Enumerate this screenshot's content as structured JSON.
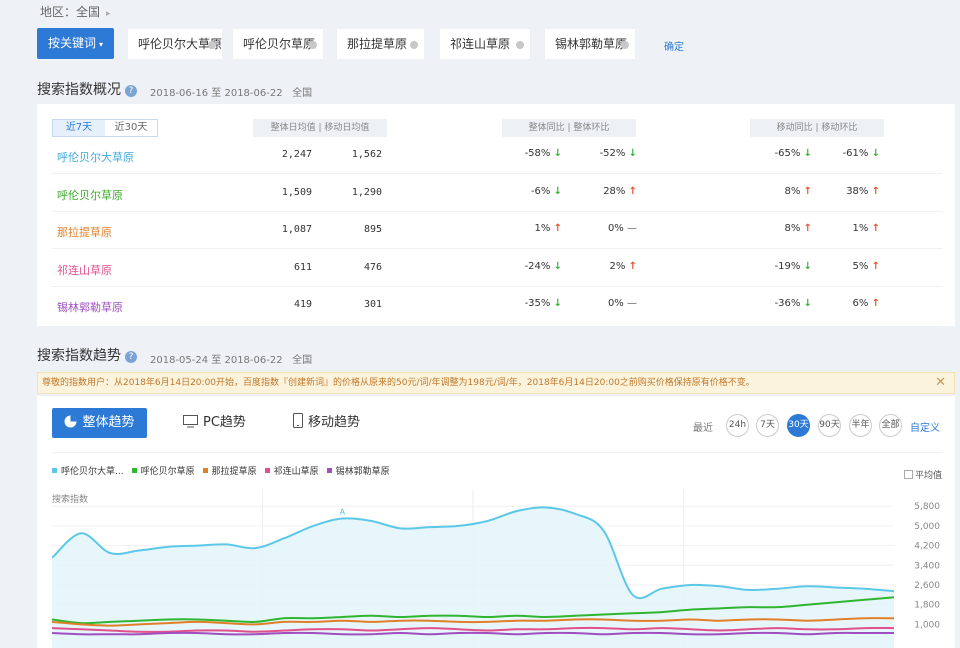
{
  "region": {
    "label": "地区：全国",
    "caret": "▸"
  },
  "keywords": {
    "button_label": "按关键词",
    "items": [
      "呼伦贝尔大草原",
      "呼伦贝尔草原",
      "那拉提草原",
      "祁连山草原",
      "锡林郭勒草原"
    ],
    "confirm": "确定"
  },
  "overview": {
    "title": "搜索指数概况",
    "help_icon": "?",
    "date_range": "2018-06-16 至 2018-06-22",
    "area": "全国",
    "tabs": [
      "近7天",
      "近30天"
    ],
    "headers": {
      "daily": "整体日均值 | 移动日均值",
      "overall": "整体同比 | 整体环比",
      "mobile": "移动同比 | 移动环比"
    },
    "rows": [
      {
        "name": "呼伦贝尔大草原",
        "color": "#3fa9d8",
        "total": "2,247",
        "mobile": "1,562",
        "o_yoy": "-58%",
        "o_yoy_dir": "down",
        "o_mom": "-52%",
        "o_mom_dir": "down",
        "m_yoy": "-65%",
        "m_yoy_dir": "down",
        "m_mom": "-61%",
        "m_mom_dir": "down"
      },
      {
        "name": "呼伦贝尔草原",
        "color": "#3daa2a",
        "total": "1,509",
        "mobile": "1,290",
        "o_yoy": "-6%",
        "o_yoy_dir": "down",
        "o_mom": "28%",
        "o_mom_dir": "up",
        "m_yoy": "8%",
        "m_yoy_dir": "up",
        "m_mom": "38%",
        "m_mom_dir": "up"
      },
      {
        "name": "那拉提草原",
        "color": "#e07f28",
        "total": "1,087",
        "mobile": "895",
        "o_yoy": "1%",
        "o_yoy_dir": "up",
        "o_mom": "0%",
        "o_mom_dir": "flat",
        "m_yoy": "8%",
        "m_yoy_dir": "up",
        "m_mom": "1%",
        "m_mom_dir": "up"
      },
      {
        "name": "祁连山草原",
        "color": "#e0508a",
        "total": "611",
        "mobile": "476",
        "o_yoy": "-24%",
        "o_yoy_dir": "down",
        "o_mom": "2%",
        "o_mom_dir": "up",
        "m_yoy": "-19%",
        "m_yoy_dir": "down",
        "m_mom": "5%",
        "m_mom_dir": "up"
      },
      {
        "name": "锡林郭勒草原",
        "color": "#a04fbf",
        "total": "419",
        "mobile": "301",
        "o_yoy": "-35%",
        "o_yoy_dir": "down",
        "o_mom": "0%",
        "o_mom_dir": "flat",
        "m_yoy": "-36%",
        "m_yoy_dir": "down",
        "m_mom": "6%",
        "m_mom_dir": "up"
      }
    ]
  },
  "trend": {
    "title": "搜索指数趋势",
    "help_icon": "?",
    "date_range": "2018-05-24 至 2018-06-22",
    "area": "全国",
    "notice": "尊敬的指数用户：从2018年6月14日20:00开始，百度指数『创建新词』的价格从原来的50元/词/年调整为198元/词/年，2018年6月14日20:00之前购买价格保持原有价格不变。",
    "notice_close": "✕",
    "modes": [
      "整体趋势",
      "PC趋势",
      "移动趋势"
    ],
    "range_label": "最近",
    "ranges": [
      "24h",
      "7天",
      "30天",
      "90天",
      "半年",
      "全部"
    ],
    "range_selected": "30天",
    "custom": "自定义",
    "legend": [
      "呼伦贝尔大草...",
      "呼伦贝尔草原",
      "那拉提草原",
      "祁连山草原",
      "锡林郭勒草原"
    ],
    "avg_label": "平均值",
    "y_label": "搜索指数",
    "peak_marker": "A"
  },
  "chart_data": {
    "type": "area",
    "ylabel": "搜索指数",
    "ylim": [
      0,
      6500
    ],
    "yticks": [
      "5,800",
      "5,000",
      "4,200",
      "3,400",
      "2,600",
      "1,800",
      "1,000"
    ],
    "grid": true,
    "legend_position": "top-left",
    "series": [
      {
        "name": "呼伦贝尔大草...",
        "color": "#5bc8e8",
        "values": [
          3700,
          4700,
          3900,
          4000,
          4150,
          4200,
          4250,
          4100,
          4500,
          5000,
          5300,
          5200,
          4900,
          4950,
          5000,
          5200,
          5600,
          5750,
          5500,
          4800,
          2200,
          2450,
          2600,
          2550,
          2400,
          2450,
          2550,
          2500,
          2450,
          2350
        ]
      },
      {
        "name": "呼伦贝尔草原",
        "color": "#2fb52f",
        "values": [
          1200,
          1050,
          1100,
          1150,
          1200,
          1200,
          1150,
          1100,
          1250,
          1250,
          1300,
          1350,
          1300,
          1350,
          1350,
          1300,
          1350,
          1300,
          1350,
          1400,
          1450,
          1500,
          1600,
          1650,
          1700,
          1700,
          1800,
          1900,
          2000,
          2100
        ]
      },
      {
        "name": "那拉提草原",
        "color": "#e07f28",
        "values": [
          1100,
          1000,
          950,
          1000,
          1050,
          1100,
          1050,
          1000,
          1100,
          1100,
          1150,
          1100,
          1150,
          1150,
          1100,
          1100,
          1150,
          1150,
          1200,
          1200,
          1150,
          1150,
          1200,
          1150,
          1200,
          1200,
          1150,
          1200,
          1250,
          1250
        ]
      },
      {
        "name": "祁连山草原",
        "color": "#e0508a",
        "values": [
          850,
          800,
          750,
          700,
          700,
          750,
          750,
          700,
          750,
          800,
          800,
          750,
          800,
          850,
          800,
          750,
          800,
          800,
          850,
          850,
          800,
          850,
          800,
          750,
          800,
          850,
          800,
          800,
          850,
          850
        ]
      },
      {
        "name": "锡林郭勒草原",
        "color": "#a04fbf",
        "values": [
          650,
          600,
          600,
          600,
          650,
          650,
          600,
          600,
          650,
          650,
          600,
          600,
          650,
          600,
          650,
          650,
          600,
          650,
          650,
          600,
          650,
          650,
          600,
          600,
          650,
          650,
          600,
          650,
          650,
          650
        ]
      }
    ]
  },
  "colors": {
    "accent": "#2c7ad6",
    "up": "#e8542e",
    "down": "#3bb33b"
  }
}
